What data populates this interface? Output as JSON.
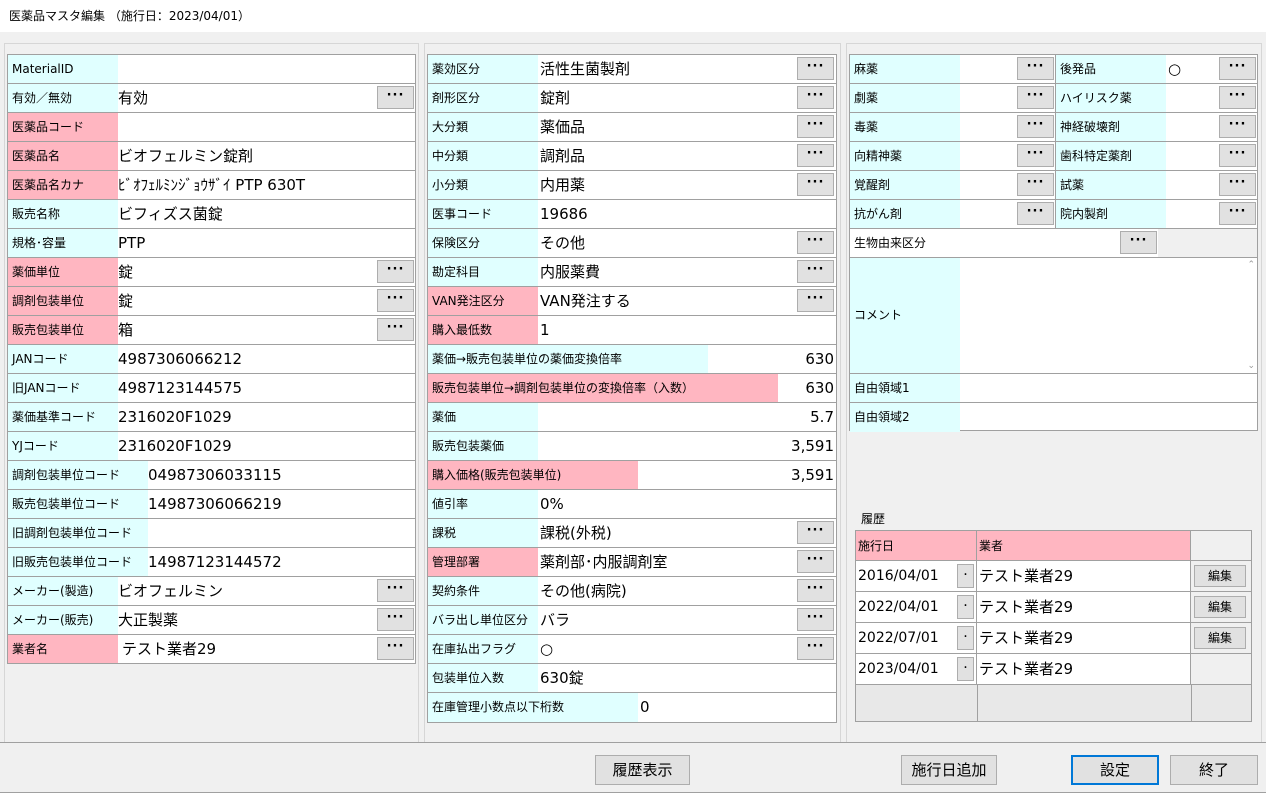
{
  "window": {
    "title": "医薬品マスタ編集 （施行日：2023/04/01）"
  },
  "dots_label": "···",
  "left_rows": [
    {
      "label": "MaterialID",
      "value": "",
      "color": "cyan",
      "lw": 110,
      "vx": 110,
      "btn": false
    },
    {
      "label": "有効／無効",
      "value": "有効",
      "color": "cyan",
      "lw": 110,
      "vx": 110,
      "btn": true
    },
    {
      "label": "医薬品コード",
      "value": "",
      "color": "pink",
      "lw": 110,
      "vx": 110,
      "btn": false
    },
    {
      "label": "医薬品名",
      "value": "ビオフェルミン錠剤",
      "color": "pink",
      "lw": 110,
      "vx": 110,
      "btn": false
    },
    {
      "label": "医薬品名カナ",
      "value": "ﾋﾞｵﾌｪﾙﾐﾝｼﾞｮｳｻﾞｲ PTP 630T",
      "color": "pink",
      "lw": 110,
      "vx": 110,
      "btn": false
    },
    {
      "label": "販売名称",
      "value": "ビフィズス菌錠",
      "color": "cyan",
      "lw": 110,
      "vx": 110,
      "btn": false
    },
    {
      "label": "規格･容量",
      "value": "PTP",
      "color": "cyan",
      "lw": 110,
      "vx": 110,
      "btn": false
    },
    {
      "label": "薬価単位",
      "value": "錠",
      "color": "pink",
      "lw": 110,
      "vx": 110,
      "btn": true
    },
    {
      "label": "調剤包装単位",
      "value": "錠",
      "color": "pink",
      "lw": 110,
      "vx": 110,
      "btn": true
    },
    {
      "label": "販売包装単位",
      "value": "箱",
      "color": "pink",
      "lw": 110,
      "vx": 110,
      "btn": true
    },
    {
      "label": "JANコード",
      "value": "4987306066212",
      "color": "cyan",
      "lw": 110,
      "vx": 110,
      "btn": false
    },
    {
      "label": "旧JANコード",
      "value": "4987123144575",
      "color": "cyan",
      "lw": 110,
      "vx": 110,
      "btn": false
    },
    {
      "label": "薬価基準コード",
      "value": "2316020F1029",
      "color": "cyan",
      "lw": 110,
      "vx": 110,
      "btn": false
    },
    {
      "label": "YJコード",
      "value": "2316020F1029",
      "color": "cyan",
      "lw": 110,
      "vx": 110,
      "btn": false
    },
    {
      "label": "調剤包装単位コード",
      "value": "04987306033115",
      "color": "cyan",
      "lw": 140,
      "vx": 140,
      "btn": false
    },
    {
      "label": "販売包装単位コード",
      "value": "14987306066219",
      "color": "cyan",
      "lw": 140,
      "vx": 140,
      "btn": false
    },
    {
      "label": "旧調剤包装単位コード",
      "value": "",
      "color": "cyan",
      "lw": 140,
      "vx": 140,
      "btn": false
    },
    {
      "label": "旧販売包装単位コード",
      "value": "14987123144572",
      "color": "cyan",
      "lw": 140,
      "vx": 140,
      "btn": false
    },
    {
      "label": "メーカー(製造)",
      "value": "ビオフェルミン",
      "color": "cyan",
      "lw": 110,
      "vx": 110,
      "btn": true
    },
    {
      "label": "メーカー(販売)",
      "value": "大正製薬",
      "color": "cyan",
      "lw": 110,
      "vx": 110,
      "btn": true
    },
    {
      "label": "業者名",
      "value": "テスト業者29",
      "color": "pink",
      "lw": 110,
      "vx": 114,
      "btn": true
    }
  ],
  "mid_rows": [
    {
      "label": "薬効区分",
      "value": "活性生菌製剤",
      "color": "cyan",
      "lw": 110,
      "btn": true,
      "num": false
    },
    {
      "label": "剤形区分",
      "value": "錠剤",
      "color": "cyan",
      "lw": 110,
      "btn": true,
      "num": false
    },
    {
      "label": "大分類",
      "value": "薬価品",
      "color": "cyan",
      "lw": 110,
      "btn": true,
      "num": false
    },
    {
      "label": "中分類",
      "value": "調剤品",
      "color": "cyan",
      "lw": 110,
      "btn": true,
      "num": false
    },
    {
      "label": "小分類",
      "value": "内用薬",
      "color": "cyan",
      "lw": 110,
      "btn": true,
      "num": false
    },
    {
      "label": "医事コード",
      "value": "19686",
      "color": "cyan",
      "lw": 110,
      "btn": false,
      "num": false
    },
    {
      "label": "保険区分",
      "value": "その他",
      "color": "cyan",
      "lw": 110,
      "btn": true,
      "num": false
    },
    {
      "label": "勘定科目",
      "value": "内服薬費",
      "color": "cyan",
      "lw": 110,
      "btn": true,
      "num": false
    },
    {
      "label": "VAN発注区分",
      "value": "VAN発注する",
      "color": "pink",
      "lw": 110,
      "btn": true,
      "num": false
    },
    {
      "label": "購入最低数",
      "value": "1",
      "color": "pink",
      "lw": 110,
      "btn": false,
      "num": false
    },
    {
      "label": "薬価→販売包装単位の薬価変換倍率",
      "value": "630",
      "color": "cyan",
      "lw": 280,
      "btn": false,
      "num": true
    },
    {
      "label": "販売包装単位→調剤包装単位の変換倍率（入数）",
      "value": "630",
      "color": "pink",
      "lw": 350,
      "btn": false,
      "num": true
    },
    {
      "label": "薬価",
      "value": "5.7",
      "color": "cyan",
      "lw": 110,
      "btn": false,
      "num": true
    },
    {
      "label": "販売包装薬価",
      "value": "3,591",
      "color": "cyan",
      "lw": 110,
      "btn": false,
      "num": true
    },
    {
      "label": "購入価格(販売包装単位)",
      "value": "3,591",
      "color": "pink",
      "lw": 210,
      "btn": false,
      "num": true
    },
    {
      "label": "値引率",
      "value": " 0%",
      "color": "cyan",
      "lw": 110,
      "btn": false,
      "num": false
    },
    {
      "label": "課税",
      "value": "課税(外税)",
      "color": "cyan",
      "lw": 110,
      "btn": true,
      "num": false
    },
    {
      "label": "管理部署",
      "value": "薬剤部･内服調剤室",
      "color": "pink",
      "lw": 110,
      "btn": true,
      "num": false
    },
    {
      "label": "契約条件",
      "value": "その他(病院)",
      "color": "cyan",
      "lw": 110,
      "btn": true,
      "num": false
    },
    {
      "label": "バラ出し単位区分",
      "value": "バラ",
      "color": "cyan",
      "lw": 110,
      "btn": true,
      "num": false
    },
    {
      "label": "在庫払出フラグ",
      "value": "○",
      "color": "cyan",
      "lw": 110,
      "btn": true,
      "num": false
    },
    {
      "label": "包装単位入数",
      "value": "630錠",
      "color": "cyan",
      "lw": 110,
      "btn": false,
      "num": false
    },
    {
      "label": "在庫管理小数点以下桁数",
      "value": "0",
      "color": "cyan",
      "lw": 210,
      "btn": false,
      "num": false
    }
  ],
  "right_pairs": [
    {
      "l": "麻薬",
      "lv": "",
      "r": "後発品",
      "rv": "○"
    },
    {
      "l": "劇薬",
      "lv": "",
      "r": "ハイリスク薬",
      "rv": ""
    },
    {
      "l": "毒薬",
      "lv": "",
      "r": "神経破壊剤",
      "rv": ""
    },
    {
      "l": "向精神薬",
      "lv": "",
      "r": "歯科特定薬剤",
      "rv": ""
    },
    {
      "l": "覚醒剤",
      "lv": "",
      "r": "試薬",
      "rv": ""
    },
    {
      "l": "抗がん剤",
      "lv": "",
      "r": "院内製剤",
      "rv": ""
    }
  ],
  "bio": {
    "label": "生物由来区分",
    "value": ""
  },
  "comment": {
    "label": "コメント",
    "value": ""
  },
  "free1": {
    "label": "自由領域1",
    "value": ""
  },
  "free2": {
    "label": "自由領域2",
    "value": ""
  },
  "history": {
    "title": "履歴",
    "col_date": "施行日",
    "col_vendor": "業者",
    "small_btn": "･",
    "edit_label": "編集",
    "rows": [
      {
        "date": "2016/04/01",
        "vendor": "テスト業者29",
        "editable": true
      },
      {
        "date": "2022/04/01",
        "vendor": "テスト業者29",
        "editable": true
      },
      {
        "date": "2022/07/01",
        "vendor": "テスト業者29",
        "editable": true
      },
      {
        "date": "2023/04/01",
        "vendor": "テスト業者29",
        "editable": false
      }
    ]
  },
  "buttons": {
    "history": "履歴表示",
    "add_date": "施行日追加",
    "ok": "設定",
    "close": "終了"
  }
}
